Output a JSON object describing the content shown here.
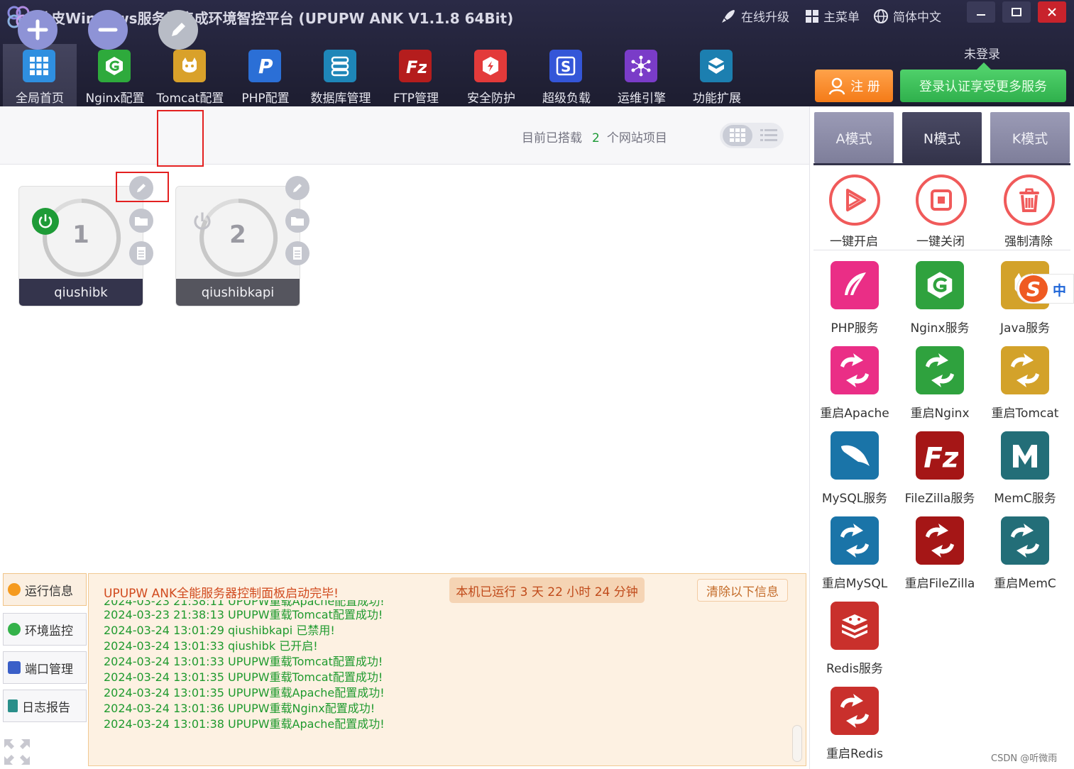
{
  "app": {
    "title": "柚皮Windows服务器集成环境智控平台   (UPUPW ANK V1.1.8 64Bit)",
    "top_links": [
      "在线升级",
      "主菜单",
      "简体中文"
    ]
  },
  "nav": {
    "items": [
      {
        "label": "全局首页",
        "icon": "grid-icon",
        "color": "#2f8fe0"
      },
      {
        "label": "Nginx配置",
        "icon": "nginx-icon",
        "color": "#2eaa3c"
      },
      {
        "label": "Tomcat配置",
        "icon": "tomcat-icon",
        "color": "#d9a12a"
      },
      {
        "label": "PHP配置",
        "icon": "php-icon",
        "color": "#2b6fd6"
      },
      {
        "label": "数据库管理",
        "icon": "database-icon",
        "color": "#1e86b8"
      },
      {
        "label": "FTP管理",
        "icon": "filezilla-icon",
        "color": "#b51d1d"
      },
      {
        "label": "安全防护",
        "icon": "shield-icon",
        "color": "#e33a3a"
      },
      {
        "label": "超级负载",
        "icon": "load-icon",
        "color": "#3456d8"
      },
      {
        "label": "运维引擎",
        "icon": "ops-icon",
        "color": "#7a3cc8"
      },
      {
        "label": "功能扩展",
        "icon": "extension-icon",
        "color": "#1c7fb0"
      }
    ]
  },
  "account": {
    "status": "未登录",
    "register_label": "注 册",
    "login_label": "登录认证享受更多服务"
  },
  "toolbar": {
    "site_count_prefix": "目前已搭载",
    "site_count": "2",
    "site_count_suffix": "个网站项目"
  },
  "sites": [
    {
      "index": "1",
      "name": "qiushibk",
      "running": true
    },
    {
      "index": "2",
      "name": "qiushibkapi",
      "running": false
    }
  ],
  "bottom_tabs": [
    "运行信息",
    "环境监控",
    "端口管理",
    "日志报告"
  ],
  "log": {
    "header": "UPUPW ANK全能服务器控制面板启动完毕!",
    "uptime": "本机已运行 3 天 22 小时 24 分钟",
    "clear_label": "清除以下信息",
    "lines": [
      "2024-03-23 21:38:11 UPUPW重载Apache配置成功!",
      "2024-03-23 21:38:13 UPUPW重载Tomcat配置成功!",
      "2024-03-24 13:01:29 qiushibkapi 已禁用!",
      "2024-03-24 13:01:33 qiushibk 已开启!",
      "2024-03-24 13:01:33 UPUPW重载Tomcat配置成功!",
      "2024-03-24 13:01:35 UPUPW重载Tomcat配置成功!",
      "2024-03-24 13:01:35 UPUPW重载Apache配置成功!",
      "2024-03-24 13:01:36 UPUPW重载Nginx配置成功!",
      "2024-03-24 13:01:38 UPUPW重载Apache配置成功!"
    ]
  },
  "modes": [
    "A模式",
    "N模式",
    "K模式"
  ],
  "quick_actions": [
    "一键开启",
    "一键关闭",
    "强制清除"
  ],
  "services": [
    {
      "label": "PHP服务",
      "icon": "feather-icon",
      "color": "#ea2e86"
    },
    {
      "label": "Nginx服务",
      "icon": "nginx-icon",
      "color": "#2fa23e"
    },
    {
      "label": "Java服务",
      "icon": "tomcat-icon",
      "color": "#d3a22a"
    },
    {
      "label": "重启Apache",
      "icon": "restart-icon",
      "color": "#ea2e86"
    },
    {
      "label": "重启Nginx",
      "icon": "restart-icon",
      "color": "#2fa23e"
    },
    {
      "label": "重启Tomcat",
      "icon": "restart-icon",
      "color": "#d3a22a"
    },
    {
      "label": "MySQL服务",
      "icon": "dolphin-icon",
      "color": "#1a74a8"
    },
    {
      "label": "FileZilla服务",
      "icon": "filezilla-icon",
      "color": "#a51616"
    },
    {
      "label": "MemC服务",
      "icon": "memcache-icon",
      "color": "#236e78"
    },
    {
      "label": "重启MySQL",
      "icon": "restart-icon",
      "color": "#1a74a8"
    },
    {
      "label": "重启FileZilla",
      "icon": "restart-icon",
      "color": "#a51616"
    },
    {
      "label": "重启MemC",
      "icon": "restart-icon",
      "color": "#236e78"
    },
    {
      "label": "Redis服务",
      "icon": "redis-icon",
      "color": "#c9302c"
    },
    {
      "label": "重启Redis",
      "icon": "restart-icon",
      "color": "#c9302c"
    }
  ],
  "ime": {
    "zh": "中"
  },
  "watermark": "CSDN @听微雨"
}
